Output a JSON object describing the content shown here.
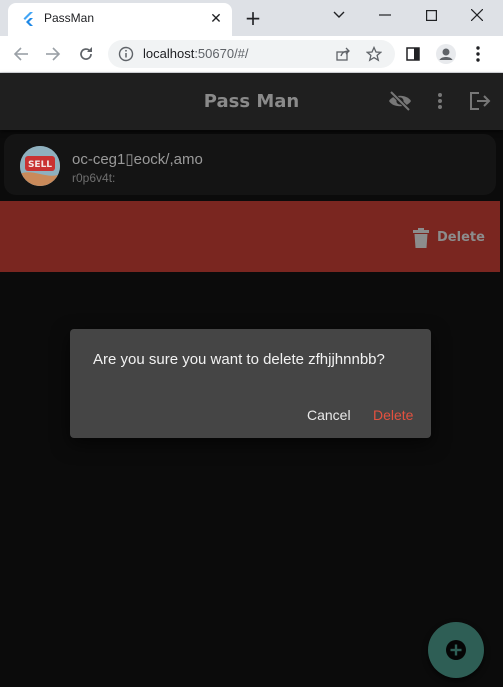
{
  "browser": {
    "tab_title": "PassMan",
    "url_host": "localhost",
    "url_rest": ":50670/#/"
  },
  "app": {
    "title": "Pass Man",
    "icons": [
      "visibility-off-icon",
      "more-vert-icon",
      "logout-icon"
    ]
  },
  "entry": {
    "title": "oc-ceg1▯eock/,amo",
    "subtitle": "r0p6v4t:",
    "avatar_text": "SELL"
  },
  "swipe_action": {
    "label": "Delete",
    "color": "#7a2620"
  },
  "dialog": {
    "message": "Are you sure you want to delete zfhjjhnnbb?",
    "cancel_label": "Cancel",
    "delete_label": "Delete",
    "delete_color": "#e3513f"
  },
  "fab": {
    "icon": "add-circle-icon",
    "color": "#2e5e55"
  }
}
